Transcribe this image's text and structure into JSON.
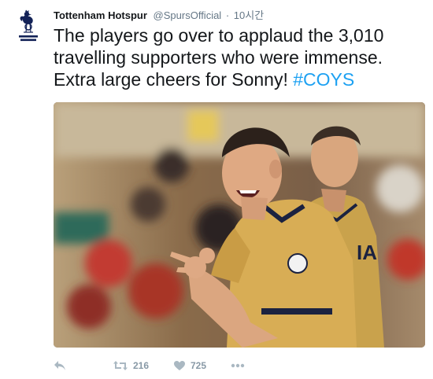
{
  "tweet": {
    "author_name": "Tottenham Hotspur",
    "handle": "@SpursOfficial",
    "separator": "·",
    "time": "10시간",
    "text_line1": "The players go over to applaud the 3,010",
    "text_line2": "travelling supporters who were immense.",
    "text_line3": "Extra large cheers for Sonny! ",
    "hashtag": "#COYS"
  },
  "actions": {
    "retweet_count": "216",
    "like_count": "725"
  },
  "colors": {
    "link": "#1da1f2",
    "action_gray": "#8899a6",
    "spurs_navy": "#132257"
  },
  "icons": [
    "spurs-logo-icon",
    "reply-icon",
    "retweet-icon",
    "heart-icon",
    "more-icon"
  ]
}
